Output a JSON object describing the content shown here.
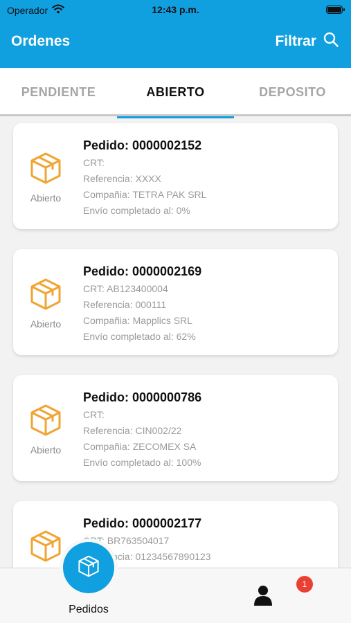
{
  "status_bar": {
    "carrier": "Operador",
    "time": "12:43 p.m."
  },
  "header": {
    "title": "Ordenes",
    "filter_label": "Filtrar",
    "background": "#109fdf"
  },
  "tabs": [
    {
      "label": "PENDIENTE",
      "active": false
    },
    {
      "label": "ABIERTO",
      "active": true
    },
    {
      "label": "DEPOSITO",
      "active": false
    }
  ],
  "orders": [
    {
      "title": "Pedido: 0000002152",
      "status": "Abierto",
      "crt": "CRT:",
      "referencia": "Referencia: XXXX",
      "compania": "Compañia: TETRA PAK SRL",
      "envio": "Envío completado al: 0%"
    },
    {
      "title": "Pedido: 0000002169",
      "status": "Abierto",
      "crt": "CRT: AB123400004",
      "referencia": "Referencia: 000111",
      "compania": "Compañia: Mapplics SRL",
      "envio": "Envío completado al: 62%"
    },
    {
      "title": "Pedido: 0000000786",
      "status": "Abierto",
      "crt": "CRT:",
      "referencia": "Referencia: CIN002/22",
      "compania": "Compañia: ZECOMEX SA",
      "envio": "Envío completado al: 100%"
    },
    {
      "title": "Pedido: 0000002177",
      "status": "",
      "crt": "CRT: BR763504017",
      "referencia": "Referencia: 01234567890123",
      "compania": "",
      "envio": ""
    }
  ],
  "bottom_nav": {
    "pedidos_label": "Pedidos",
    "notification_count": "1"
  },
  "colors": {
    "accent": "#109fdf",
    "icon_orange": "#f0a532",
    "badge_red": "#ea3f33"
  },
  "icons": [
    "wifi-icon",
    "battery-icon",
    "search-icon",
    "box-icon",
    "user-icon"
  ]
}
